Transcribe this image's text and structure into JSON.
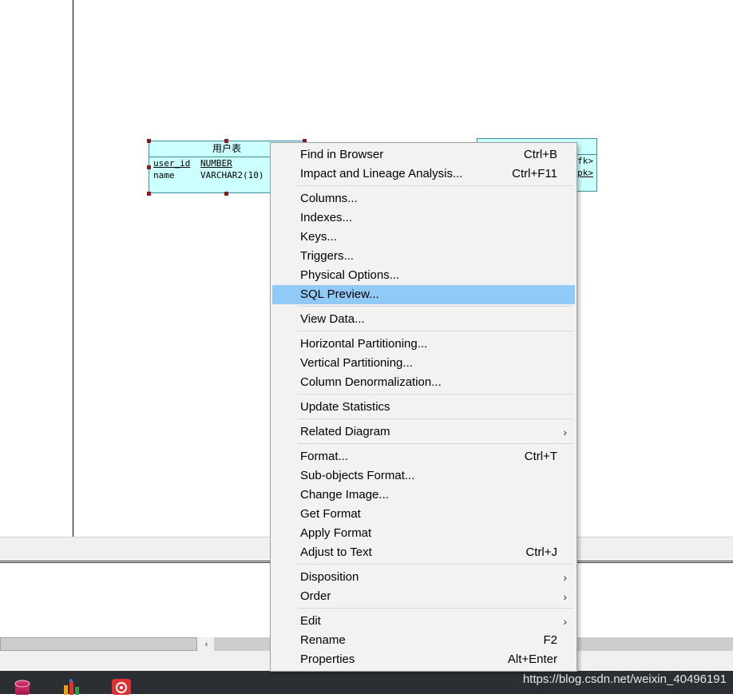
{
  "diagram": {
    "table1": {
      "title": "用户表",
      "columns": [
        {
          "name": "user_id",
          "type": "NUMBER"
        },
        {
          "name": "name",
          "type": "VARCHAR2(10)"
        }
      ]
    },
    "table2": {
      "fk1": "fk>",
      "fk2": "pk>"
    }
  },
  "scroll": {
    "left_arrow": "‹"
  },
  "taskbar": {
    "watermark": "https://blog.csdn.net/weixin_40496191"
  },
  "menu": {
    "items": [
      {
        "label": "Find in Browser",
        "shortcut": "Ctrl+B"
      },
      {
        "label": "Impact and Lineage Analysis...",
        "shortcut": "Ctrl+F11"
      },
      {
        "label": "Columns...",
        "shortcut": ""
      },
      {
        "label": "Indexes...",
        "shortcut": ""
      },
      {
        "label": "Keys...",
        "shortcut": ""
      },
      {
        "label": "Triggers...",
        "shortcut": ""
      },
      {
        "label": "Physical Options...",
        "shortcut": ""
      },
      {
        "label": "SQL Preview...",
        "shortcut": ""
      },
      {
        "label": "View Data...",
        "shortcut": ""
      },
      {
        "label": "Horizontal Partitioning...",
        "shortcut": ""
      },
      {
        "label": "Vertical Partitioning...",
        "shortcut": ""
      },
      {
        "label": "Column Denormalization...",
        "shortcut": ""
      },
      {
        "label": "Update Statistics",
        "shortcut": ""
      },
      {
        "label": "Related Diagram",
        "shortcut": ""
      },
      {
        "label": "Format...",
        "shortcut": "Ctrl+T"
      },
      {
        "label": "Sub-objects Format...",
        "shortcut": ""
      },
      {
        "label": "Change Image...",
        "shortcut": ""
      },
      {
        "label": "Get Format",
        "shortcut": ""
      },
      {
        "label": "Apply Format",
        "shortcut": ""
      },
      {
        "label": "Adjust to Text",
        "shortcut": "Ctrl+J"
      },
      {
        "label": "Disposition",
        "shortcut": ""
      },
      {
        "label": "Order",
        "shortcut": ""
      },
      {
        "label": "Edit",
        "shortcut": ""
      },
      {
        "label": "Rename",
        "shortcut": "F2"
      },
      {
        "label": "Properties",
        "shortcut": "Alt+Enter"
      }
    ],
    "submenu_arrow": "›",
    "highlight_color": "#91c9f7"
  }
}
